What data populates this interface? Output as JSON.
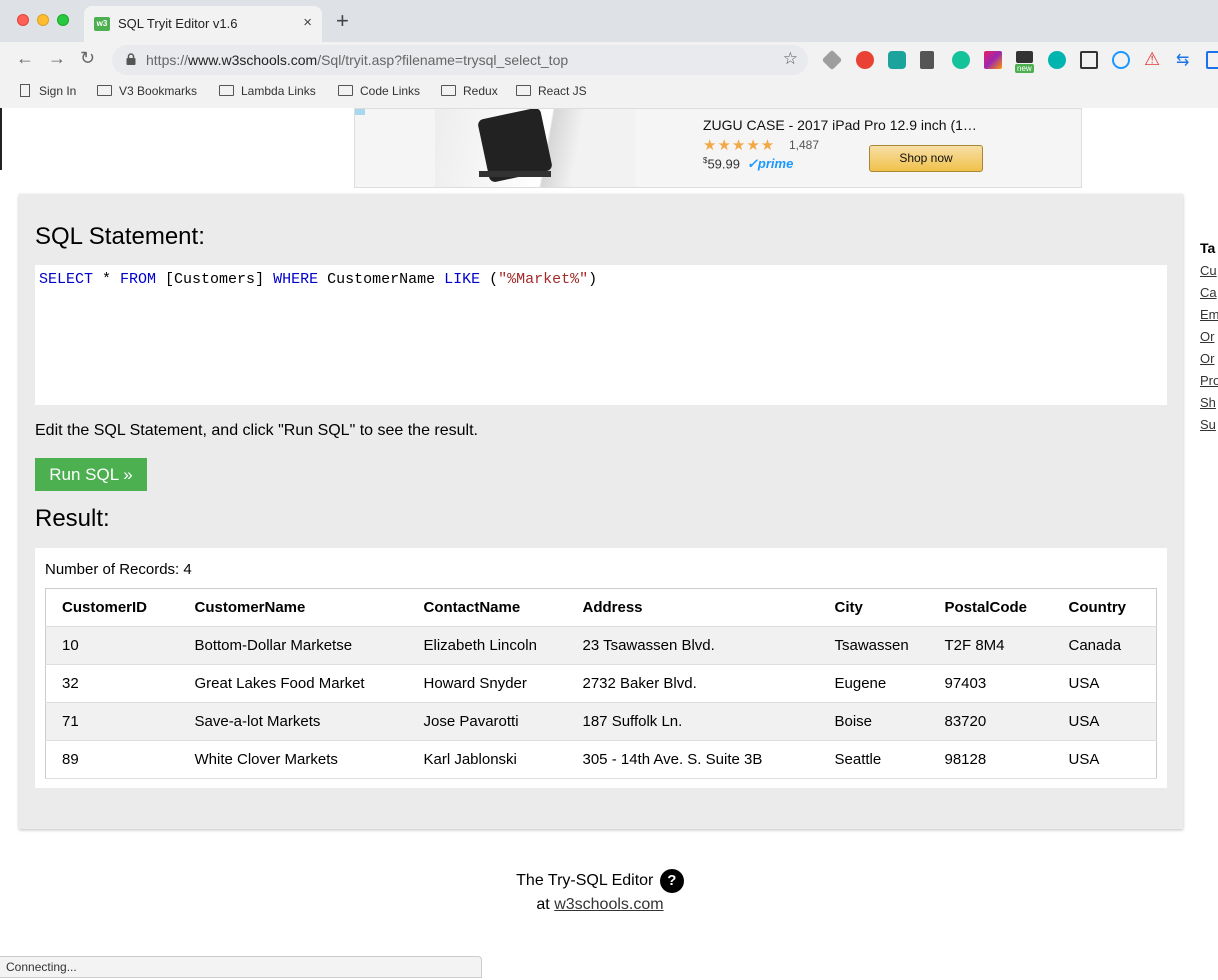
{
  "browser": {
    "tab_title": "SQL Tryit Editor v1.6",
    "tab_favicon_text": "w3",
    "tab_close": "×",
    "new_tab": "+",
    "url_prefix": "https://",
    "url_host": "www.w3schools.com",
    "url_path": "/Sql/tryit.asp?filename=trysql_select_top",
    "bookmarks": [
      "Sign In",
      "V3 Bookmarks",
      "Lambda Links",
      "Code Links",
      "Redux",
      "React JS"
    ],
    "extension_badge": "new"
  },
  "ad": {
    "title": "ZUGU CASE - 2017 iPad Pro 12.9 inch (1…",
    "stars": "★★★★★",
    "review_count": "1,487",
    "price_symbol": "$",
    "price": "59.99",
    "prime": "✓prime",
    "button": "Shop now"
  },
  "editor": {
    "sql_heading": "SQL Statement:",
    "sql_parts": {
      "kw1": "SELECT",
      "t1": " * ",
      "kw2": "FROM",
      "t2": " [Customers] ",
      "kw3": "WHERE",
      "t3": " CustomerName ",
      "kw4": "LIKE",
      "t4": " (",
      "str": "\"%Market%\"",
      "t5": ")"
    },
    "instruction": "Edit the SQL Statement, and click \"Run SQL\" to see the result.",
    "run_button": "Run SQL »",
    "result_heading": "Result:",
    "records": "Number of Records: 4"
  },
  "table": {
    "headers": [
      "CustomerID",
      "CustomerName",
      "ContactName",
      "Address",
      "City",
      "PostalCode",
      "Country"
    ],
    "rows": [
      [
        "10",
        "Bottom-Dollar Marketse",
        "Elizabeth Lincoln",
        "23 Tsawassen Blvd.",
        "Tsawassen",
        "T2F 8M4",
        "Canada"
      ],
      [
        "32",
        "Great Lakes Food Market",
        "Howard Snyder",
        "2732 Baker Blvd.",
        "Eugene",
        "97403",
        "USA"
      ],
      [
        "71",
        "Save-a-lot Markets",
        "Jose Pavarotti",
        "187 Suffolk Ln.",
        "Boise",
        "83720",
        "USA"
      ],
      [
        "89",
        "White Clover Markets",
        "Karl Jablonski",
        "305 - 14th Ave. S. Suite 3B",
        "Seattle",
        "98128",
        "USA"
      ]
    ]
  },
  "sidebar": {
    "title": "Ta",
    "links": [
      "Cu",
      "Ca",
      "Em",
      "Or",
      "Or",
      "Pro",
      "Sh",
      "Su"
    ]
  },
  "footer": {
    "line1": "The Try-SQL Editor",
    "help": "?",
    "line2_prefix": "at ",
    "link": "w3schools.com"
  },
  "status": "Connecting...",
  "colors": {
    "accent": "#4caf50",
    "keyword": "#0000cd",
    "string": "#a52a2a"
  }
}
